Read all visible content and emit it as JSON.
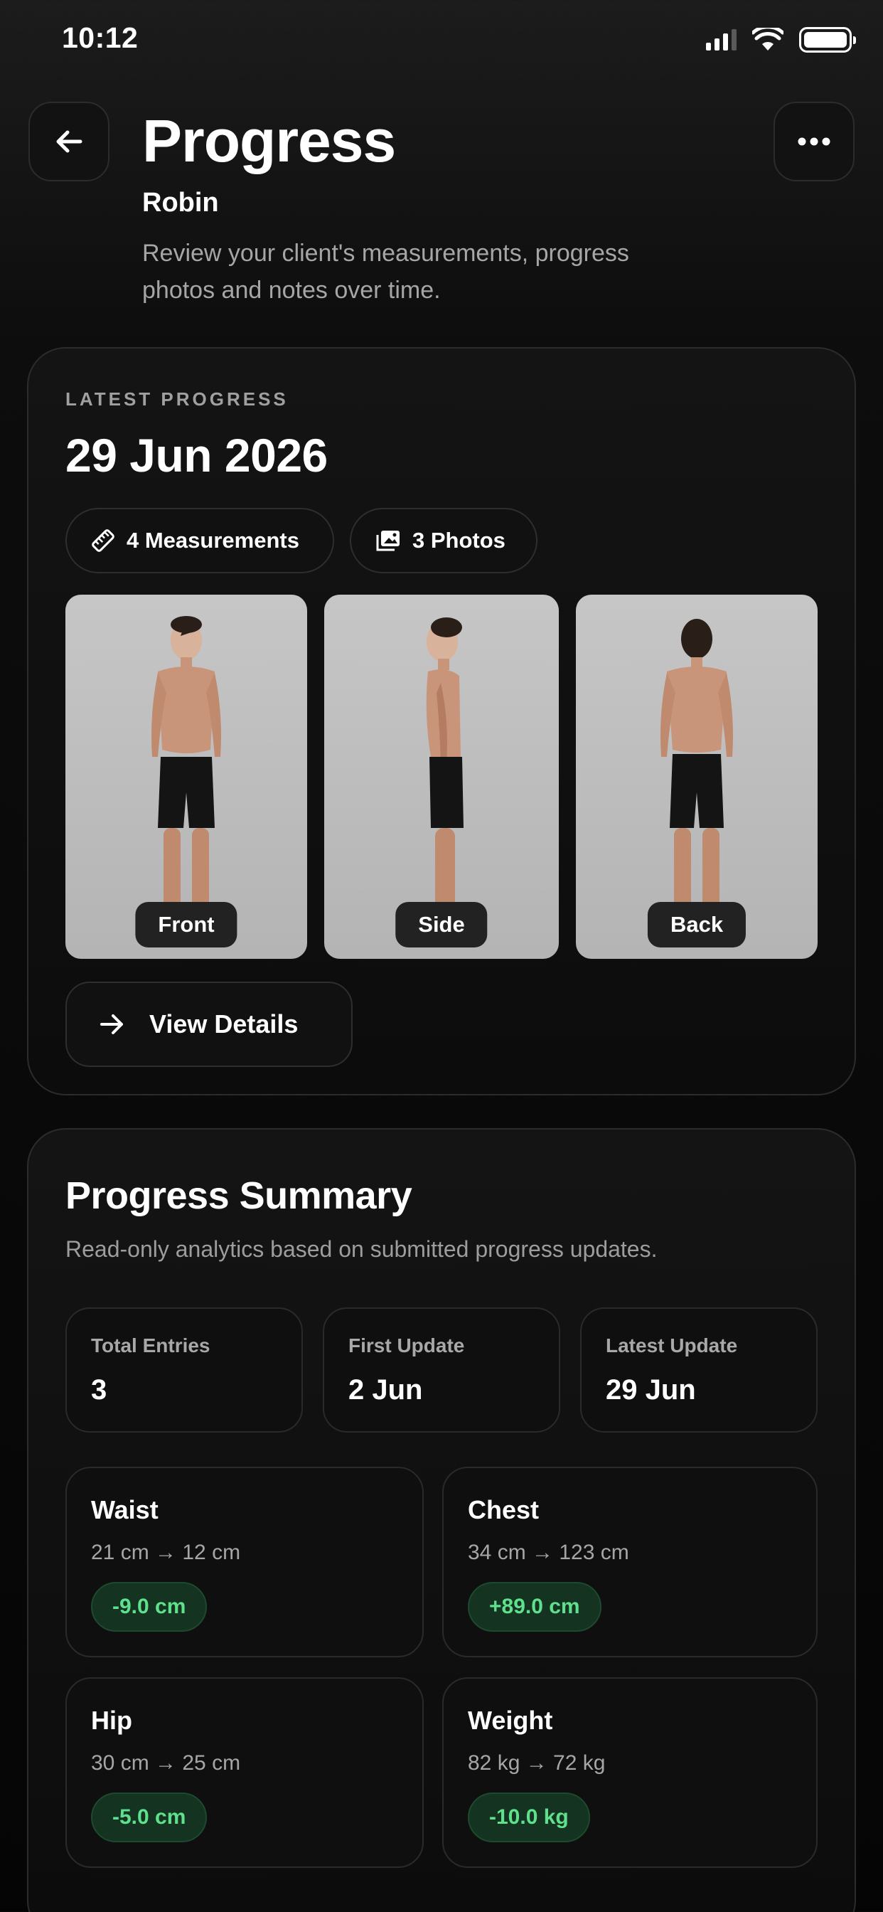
{
  "status_bar": {
    "time": "10:12"
  },
  "header": {
    "title": "Progress",
    "client_name": "Robin",
    "description": "Review your client's measurements, progress photos and notes over time."
  },
  "latest": {
    "eyebrow": "LATEST PROGRESS",
    "date": "29 Jun 2026",
    "measurements_pill": "4 Measurements",
    "photos_pill": "3 Photos",
    "photos": [
      {
        "label": "Front"
      },
      {
        "label": "Side"
      },
      {
        "label": "Back"
      }
    ],
    "view_details": "View Details"
  },
  "summary": {
    "title": "Progress Summary",
    "description": "Read-only analytics based on submitted progress updates.",
    "stats": [
      {
        "label": "Total Entries",
        "value": "3"
      },
      {
        "label": "First Update",
        "value": "2 Jun"
      },
      {
        "label": "Latest Update",
        "value": "29 Jun"
      }
    ],
    "metrics": [
      {
        "name": "Waist",
        "range": "21 cm → 12 cm",
        "delta": "-9.0 cm"
      },
      {
        "name": "Chest",
        "range": "34 cm → 123 cm",
        "delta": "+89.0 cm"
      },
      {
        "name": "Hip",
        "range": "30 cm → 25 cm",
        "delta": "-5.0 cm"
      },
      {
        "name": "Weight",
        "range": "82 kg → 72 kg",
        "delta": "-10.0 kg"
      }
    ]
  },
  "colors": {
    "background": "#050505",
    "card_border": "#2c2c2c",
    "delta_positive_text": "#5fe08c",
    "delta_badge_bg": "#143321"
  },
  "icons": [
    "back-arrow-icon",
    "more-dots-icon",
    "ruler-icon",
    "photos-icon",
    "arrow-right-icon",
    "signal-icon",
    "wifi-icon",
    "battery-icon"
  ]
}
